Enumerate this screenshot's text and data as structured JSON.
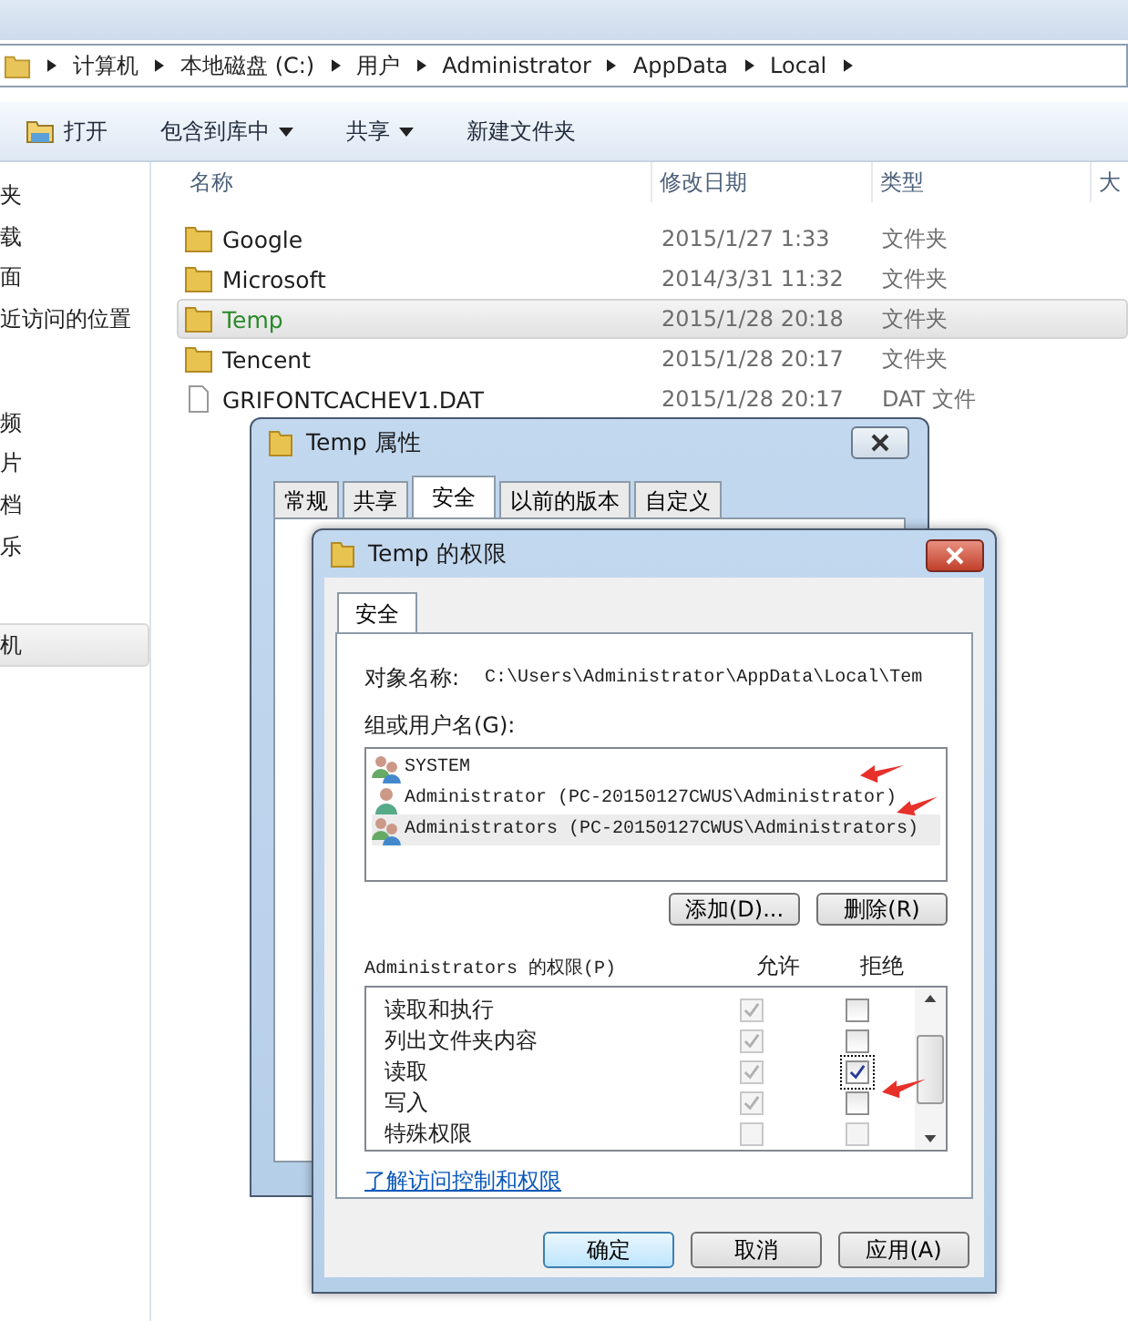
{
  "explorer": {
    "breadcrumbs": [
      "计算机",
      "本地磁盘 (C:)",
      "用户",
      "Administrator",
      "AppData",
      "Local"
    ],
    "toolbar": [
      {
        "label": "打开",
        "kind": "open"
      },
      {
        "label": "包含到库中",
        "kind": "menu"
      },
      {
        "label": "共享",
        "kind": "menu"
      },
      {
        "label": "新建文件夹",
        "kind": "plain"
      }
    ],
    "sidebar_groups": [
      [
        {
          "label": "夹",
          "selected": false
        },
        {
          "label": "载",
          "selected": false
        },
        {
          "label": "面",
          "selected": false
        },
        {
          "label": "近访问的位置",
          "selected": false
        }
      ],
      [
        {
          "label": "频",
          "selected": false
        },
        {
          "label": "片",
          "selected": false
        },
        {
          "label": "档",
          "selected": false
        },
        {
          "label": "乐",
          "selected": false
        }
      ],
      [
        {
          "label": "机",
          "selected": true
        }
      ]
    ],
    "columns": [
      "名称",
      "修改日期",
      "类型",
      "大"
    ],
    "rows": [
      {
        "name": "Google",
        "date": "2015/1/27 1:33",
        "type": "文件夹",
        "kind": "folder",
        "selected": false
      },
      {
        "name": "Microsoft",
        "date": "2014/3/31 11:32",
        "type": "文件夹",
        "kind": "folder",
        "selected": false
      },
      {
        "name": "Temp",
        "date": "2015/1/28 20:18",
        "type": "文件夹",
        "kind": "folder",
        "selected": true
      },
      {
        "name": "Tencent",
        "date": "2015/1/28 20:17",
        "type": "文件夹",
        "kind": "folder",
        "selected": false
      },
      {
        "name": "GRIFONTCACHEV1.DAT",
        "date": "2015/1/28 20:17",
        "type": "DAT 文件",
        "kind": "file",
        "selected": false
      }
    ]
  },
  "properties_dialog": {
    "title": "Temp 属性",
    "tabs": [
      {
        "label": "常规",
        "selected": false
      },
      {
        "label": "共享",
        "selected": false
      },
      {
        "label": "安全",
        "selected": true
      },
      {
        "label": "以前的版本",
        "selected": false
      },
      {
        "label": "自定义",
        "selected": false
      }
    ]
  },
  "permissions_dialog": {
    "title": "Temp 的权限",
    "tab": "安全",
    "object_label": "对象名称:",
    "object_value": "C:\\Users\\Administrator\\AppData\\Local\\Tem",
    "users_label": "组或用户名(G):",
    "users": [
      {
        "name": "SYSTEM",
        "kind": "group",
        "selected": false
      },
      {
        "name": "Administrator (PC-20150127CWUS\\Administrator)",
        "kind": "user",
        "selected": false
      },
      {
        "name": "Administrators (PC-20150127CWUS\\Administrators)",
        "kind": "group",
        "selected": true
      }
    ],
    "user_buttons": [
      "添加(D)...",
      "删除(R)"
    ],
    "perm_label": "Administrators 的权限(P)",
    "allow_label": "允许",
    "deny_label": "拒绝",
    "permissions": [
      {
        "name": "读取和执行",
        "allow": {
          "checked": true,
          "disabled": true
        },
        "deny": {
          "checked": false,
          "disabled": false
        }
      },
      {
        "name": "列出文件夹内容",
        "allow": {
          "checked": true,
          "disabled": true
        },
        "deny": {
          "checked": false,
          "disabled": false
        }
      },
      {
        "name": "读取",
        "allow": {
          "checked": true,
          "disabled": true
        },
        "deny": {
          "checked": true,
          "disabled": false
        }
      },
      {
        "name": "写入",
        "allow": {
          "checked": true,
          "disabled": true
        },
        "deny": {
          "checked": false,
          "disabled": false
        }
      },
      {
        "name": "特殊权限",
        "allow": {
          "checked": false,
          "disabled": true
        },
        "deny": {
          "checked": false,
          "disabled": true
        }
      }
    ],
    "link": "了解访问控制和权限",
    "buttons": [
      {
        "label": "确定",
        "default": true
      },
      {
        "label": "取消",
        "default": false
      },
      {
        "label": "应用(A)",
        "default": false
      }
    ]
  }
}
